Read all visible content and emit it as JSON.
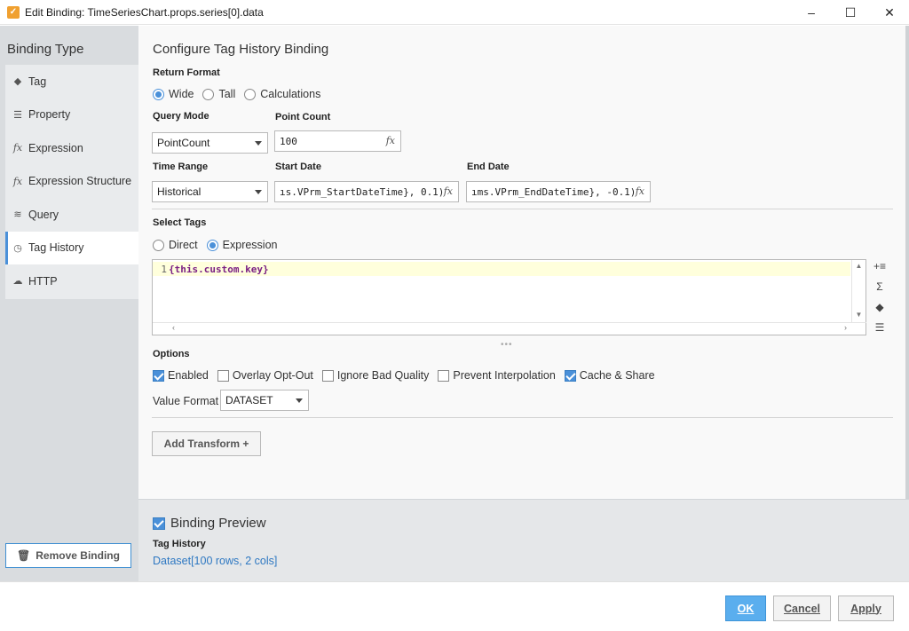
{
  "window": {
    "icon": "app-logo-icon",
    "title": "Edit Binding: TimeSeriesChart.props.series[0].data",
    "minimize": "–",
    "maximize": "☐",
    "close": "✕"
  },
  "sidebar": {
    "heading": "Binding Type",
    "items": [
      {
        "label": "Tag",
        "icon": "tag-icon"
      },
      {
        "label": "Property",
        "icon": "property-icon"
      },
      {
        "label": "Expression",
        "icon": "fx-icon"
      },
      {
        "label": "Expression Structure",
        "icon": "fx-icon"
      },
      {
        "label": "Query",
        "icon": "database-icon"
      },
      {
        "label": "Tag History",
        "icon": "clock-icon"
      },
      {
        "label": "HTTP",
        "icon": "cloud-icon"
      }
    ],
    "active": "Tag History",
    "remove_label": "Remove Binding"
  },
  "config": {
    "title": "Configure Tag History Binding",
    "return_format": {
      "label": "Return Format",
      "options": [
        "Wide",
        "Tall",
        "Calculations"
      ],
      "selected": "Wide"
    },
    "query_mode": {
      "label": "Query Mode",
      "value": "PointCount"
    },
    "point_count": {
      "label": "Point Count",
      "value": "100"
    },
    "time_range": {
      "label": "Time Range",
      "value": "Historical"
    },
    "start_date": {
      "label": "Start Date",
      "value": "ıs.VPrm_StartDateTime}, 0.1)"
    },
    "end_date": {
      "label": "End Date",
      "value": "ıms.VPrm_EndDateTime}, -0.1)"
    },
    "fx_label": "fx",
    "select_tags": {
      "label": "Select Tags",
      "options": [
        "Direct",
        "Expression"
      ],
      "selected": "Expression"
    },
    "editor": {
      "line_number": "1",
      "code": "{this.custom.key}"
    },
    "options": {
      "label": "Options",
      "items": [
        {
          "label": "Enabled",
          "checked": true
        },
        {
          "label": "Overlay Opt-Out",
          "checked": false
        },
        {
          "label": "Ignore Bad Quality",
          "checked": false
        },
        {
          "label": "Prevent Interpolation",
          "checked": false
        },
        {
          "label": "Cache & Share",
          "checked": true
        }
      ]
    },
    "value_format": {
      "label": "Value Format",
      "value": "DATASET"
    },
    "add_transform_label": "Add Transform +"
  },
  "preview": {
    "title": "Binding Preview",
    "checked": true,
    "subtitle": "Tag History",
    "value": "Dataset[100 rows, 2 cols]"
  },
  "footer": {
    "ok": "OK",
    "cancel": "Cancel",
    "apply": "Apply"
  },
  "colors": {
    "accent": "#4a90d9",
    "sidebar_bg": "#d9dcdf",
    "editor_highlight": "#ffffdc",
    "primary_button": "#5aaeee"
  }
}
